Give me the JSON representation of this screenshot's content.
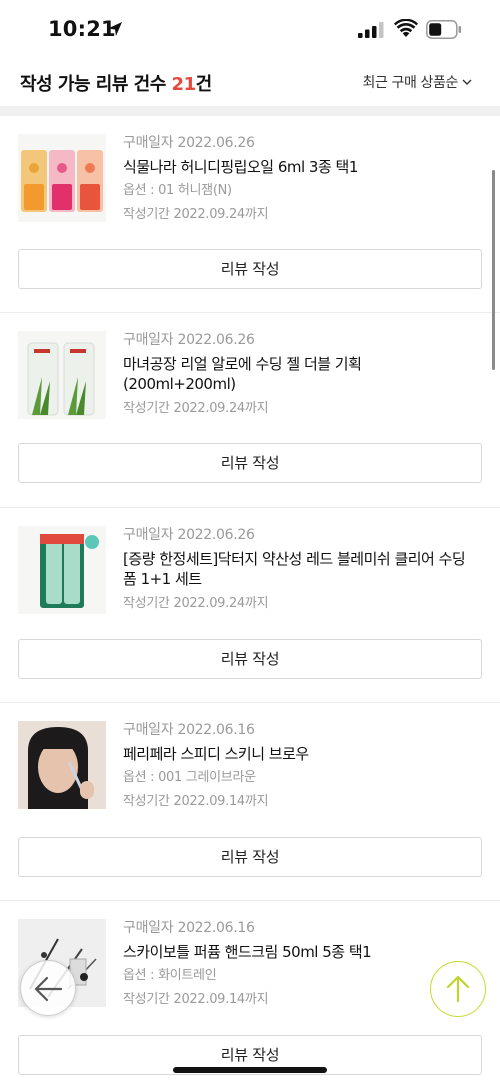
{
  "status_bar": {
    "time": "10:21"
  },
  "header": {
    "title_prefix": "작성 가능 리뷰 건수 ",
    "count": "21",
    "title_suffix": "건",
    "sort_label": "최근 구매 상품순"
  },
  "colors": {
    "accent": "#e6483d",
    "top_button": "#c9da2b"
  },
  "reviews": [
    {
      "purchase_date": "구매일자 2022.06.26",
      "product_name": "식물나라 허니디핑립오일 6ml 3종 택1",
      "option": "옵션 : 01 허니잼(N)",
      "deadline": "작성기간 2022.09.24까지",
      "button_label": "리뷰 작성"
    },
    {
      "purchase_date": "구매일자 2022.06.26",
      "product_name": "마녀공장 리얼 알로에 수딩 젤 더블 기획 (200ml+200ml)",
      "option": "",
      "deadline": "작성기간 2022.09.24까지",
      "button_label": "리뷰 작성"
    },
    {
      "purchase_date": "구매일자 2022.06.26",
      "product_name": "[증량 한정세트]닥터지 약산성 레드 블레미쉬 클리어 수딩 폼 1+1 세트",
      "option": "",
      "deadline": "작성기간 2022.09.24까지",
      "button_label": "리뷰 작성"
    },
    {
      "purchase_date": "구매일자 2022.06.16",
      "product_name": "페리페라 스피디 스키니 브로우",
      "option": "옵션 : 001 그레이브라운",
      "deadline": "작성기간 2022.09.14까지",
      "button_label": "리뷰 작성"
    },
    {
      "purchase_date": "구매일자 2022.06.16",
      "product_name": "스카이보틀 퍼퓸 핸드크림 50ml 5종 택1",
      "option": "옵션 : 화이트레인",
      "deadline": "작성기간 2022.09.14까지",
      "button_label": "리뷰 작성"
    }
  ],
  "icons": {
    "back": "arrow-left-icon",
    "top": "arrow-up-icon"
  }
}
